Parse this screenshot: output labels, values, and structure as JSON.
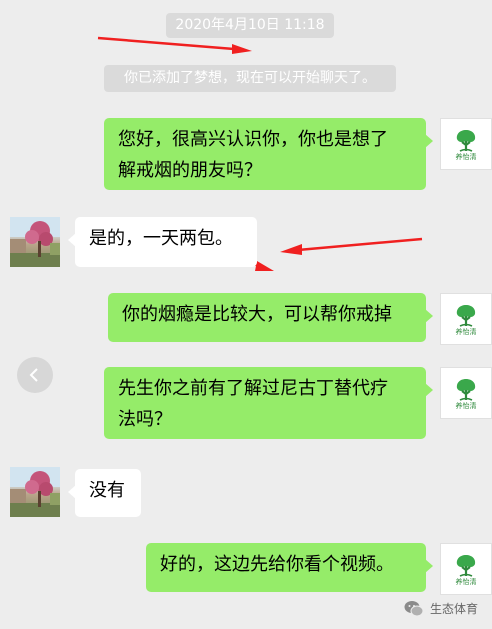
{
  "chat": {
    "timestamp": "2020年4月10日 11:18",
    "system_notice": "你已添加了梦想，现在可以开始聊天了。",
    "messages": [
      {
        "sender": "me",
        "line1": "您好，很高兴认识你，你也是想了",
        "line2": "解戒烟的朋友吗？"
      },
      {
        "sender": "other",
        "line1": "是的，一天两包。"
      },
      {
        "sender": "me",
        "line1": "你的烟瘾是比较大，可以帮你戒掉"
      },
      {
        "sender": "me",
        "line1": "先生你之前有了解过尼古丁替代疗",
        "line2": "法吗？"
      },
      {
        "sender": "other",
        "line1": "没有"
      },
      {
        "sender": "me",
        "line1": "好的，这边先给你看个视频。"
      }
    ]
  },
  "my_avatar": {
    "brand_text": "养怡清",
    "icon": "tree-logo-icon"
  },
  "other_avatar": {
    "icon": "flowering-tree-photo"
  },
  "watermark": {
    "text": "生态体育",
    "icon": "wechat-icon"
  },
  "colors": {
    "background": "#ededed",
    "my_bubble": "#95ec69",
    "other_bubble": "#ffffff",
    "annotation_arrow": "#f02020"
  }
}
